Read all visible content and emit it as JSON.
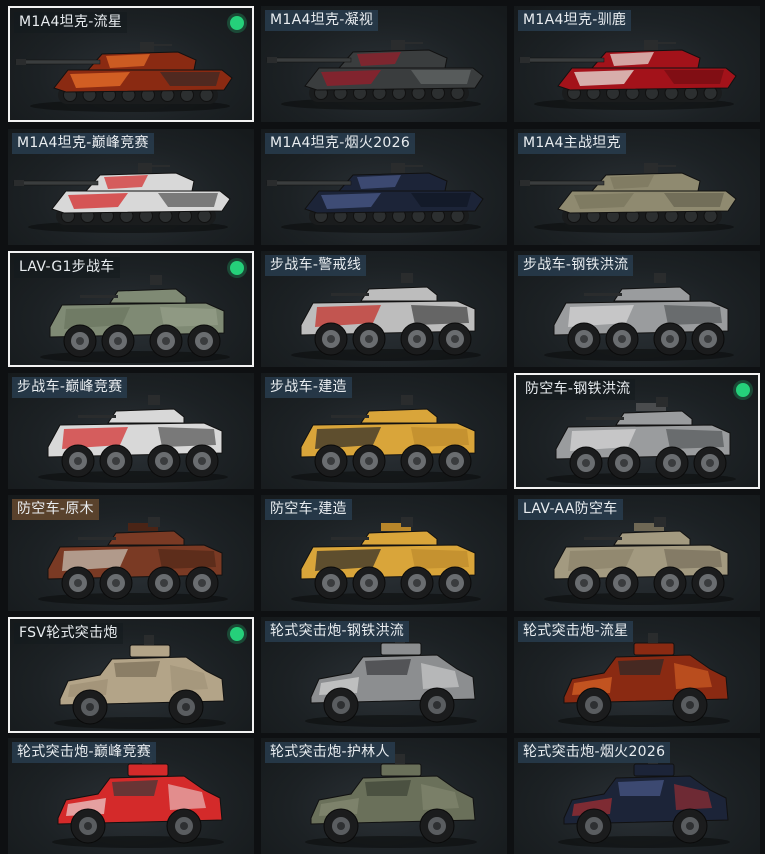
{
  "tiles": [
    {
      "label": "M1A4坦克-流星",
      "type": "tank",
      "selected": true,
      "owned": true,
      "body": "#8a2a12",
      "accent": "#e8702a",
      "alt": "#2a2a2a"
    },
    {
      "label": "M1A4坦克-凝视",
      "type": "tank",
      "selected": false,
      "owned": false,
      "body": "#3a3d3e",
      "accent": "#9a1c2a",
      "alt": "#6b6f70"
    },
    {
      "label": "M1A4坦克-驯鹿",
      "type": "tank",
      "selected": false,
      "owned": false,
      "body": "#a3121a",
      "accent": "#e8e3dc",
      "alt": "#6a0b10"
    },
    {
      "label": "M1A4坦克-巅峰竞赛",
      "type": "tank",
      "selected": false,
      "owned": false,
      "body": "#d8d8d8",
      "accent": "#d42a2a",
      "alt": "#3a3a3a"
    },
    {
      "label": "M1A4坦克-烟火2026",
      "type": "tank",
      "selected": false,
      "owned": false,
      "body": "#1c2438",
      "accent": "#4a5a8a",
      "alt": "#0e1420"
    },
    {
      "label": "M1A4主战坦克",
      "type": "tank",
      "selected": false,
      "owned": false,
      "body": "#8f8a70",
      "accent": "#7a765e",
      "alt": "#5f5c49"
    },
    {
      "label": "LAV-G1步战车",
      "type": "ifv",
      "selected": true,
      "owned": true,
      "body": "#7f8a74",
      "accent": "#6a7560",
      "alt": "#9aa38d"
    },
    {
      "label": "步战车-警戒线",
      "type": "ifv",
      "selected": false,
      "owned": false,
      "body": "#bdbdbd",
      "accent": "#c42a22",
      "alt": "#2a2a2a"
    },
    {
      "label": "步战车-钢铁洪流",
      "type": "ifv",
      "selected": false,
      "owned": false,
      "body": "#9a9c9e",
      "accent": "#d8d8d8",
      "alt": "#4a4c4e"
    },
    {
      "label": "步战车-巅峰竞赛",
      "type": "ifv",
      "selected": false,
      "owned": false,
      "body": "#d8d8d8",
      "accent": "#d42a2a",
      "alt": "#3a3a3a"
    },
    {
      "label": "步战车-建造",
      "type": "ifv",
      "selected": false,
      "owned": false,
      "body": "#d9a53a",
      "accent": "#2a2a2a",
      "alt": "#b8862a"
    },
    {
      "label": "防空车-钢铁洪流",
      "type": "aa",
      "selected": true,
      "owned": true,
      "body": "#9a9c9e",
      "accent": "#d8d8d8",
      "alt": "#4a4c4e"
    },
    {
      "label": "防空车-原木",
      "type": "aa",
      "selected": false,
      "owned": false,
      "body": "#7a3a24",
      "accent": "#c9c3b8",
      "alt": "#4a2416",
      "warm": true
    },
    {
      "label": "防空车-建造",
      "type": "aa",
      "selected": false,
      "owned": false,
      "body": "#d9a53a",
      "accent": "#2a2a2a",
      "alt": "#b8862a"
    },
    {
      "label": "LAV-AA防空车",
      "type": "aa",
      "selected": false,
      "owned": false,
      "body": "#a39a80",
      "accent": "#8a826a",
      "alt": "#6f6855"
    },
    {
      "label": "FSV轮式突击炮",
      "type": "fsv",
      "selected": true,
      "owned": true,
      "body": "#b3a488",
      "accent": "#9a8c72",
      "alt": "#7a6e58"
    },
    {
      "label": "轮式突击炮-钢铁洪流",
      "type": "fsv",
      "selected": false,
      "owned": false,
      "body": "#8c8e90",
      "accent": "#e0e0e0",
      "alt": "#3a3c3e"
    },
    {
      "label": "轮式突击炮-流星",
      "type": "fsv",
      "selected": false,
      "owned": false,
      "body": "#8a2a12",
      "accent": "#e8702a",
      "alt": "#2a2a2a"
    },
    {
      "label": "轮式突击炮-巅峰竞赛",
      "type": "fsv",
      "selected": false,
      "owned": false,
      "body": "#d42a2a",
      "accent": "#f0f0f0",
      "alt": "#3a3a3a"
    },
    {
      "label": "轮式突击炮-护林人",
      "type": "fsv",
      "selected": false,
      "owned": false,
      "body": "#6a705a",
      "accent": "#8a8e76",
      "alt": "#3f4436"
    },
    {
      "label": "轮式突击炮-烟火2026",
      "type": "fsv",
      "selected": false,
      "owned": false,
      "body": "#1c2438",
      "accent": "#c03030",
      "alt": "#4a5a8a"
    }
  ]
}
